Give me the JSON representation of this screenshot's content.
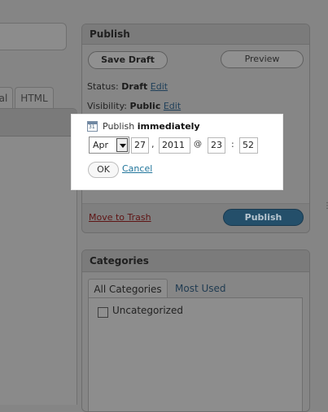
{
  "editor": {
    "tabs": [
      {
        "label": "al"
      },
      {
        "label": "HTML"
      }
    ]
  },
  "publish": {
    "title": "Publish",
    "save_draft_label": "Save Draft",
    "preview_label": "Preview",
    "status": {
      "label": "Status:",
      "value": "Draft",
      "edit_label": "Edit"
    },
    "visibility": {
      "label": "Visibility:",
      "value": "Public",
      "edit_label": "Edit"
    },
    "timestamp": {
      "label": "Publish",
      "value": "immediately",
      "month": "Apr",
      "day": "27",
      "day_sep": ",",
      "year": "2011",
      "at_sep": "@",
      "hour": "23",
      "time_sep": ":",
      "minute": "52",
      "ok_label": "OK",
      "cancel_label": "Cancel"
    },
    "trash_label": "Move to Trash",
    "publish_label": "Publish"
  },
  "categories": {
    "title": "Categories",
    "tabs": [
      {
        "label": "All Categories"
      },
      {
        "label": "Most Used"
      }
    ],
    "items": [
      {
        "label": "Uncategorized",
        "checked": false
      }
    ]
  },
  "colors": {
    "overlay": "#858585",
    "popup_bg": "#ffffff",
    "link": "#21759b",
    "publish_button": "#244f6a"
  }
}
